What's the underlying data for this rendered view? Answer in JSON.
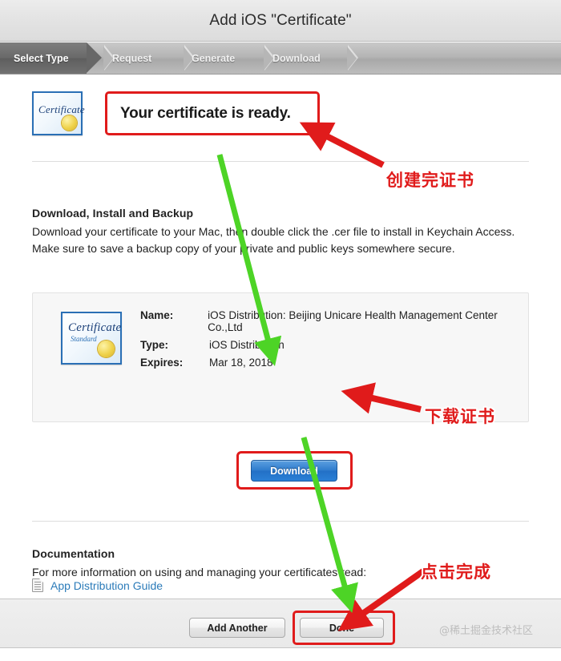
{
  "window": {
    "title": "Add iOS \"Certificate\""
  },
  "steps": [
    {
      "label": "Select Type",
      "state": "active"
    },
    {
      "label": "Request",
      "state": "inactive"
    },
    {
      "label": "Generate",
      "state": "inactive"
    },
    {
      "label": "Download",
      "state": "inactive"
    }
  ],
  "ready": {
    "message": "Your certificate is ready.",
    "icon_word": "Certificate"
  },
  "download_section": {
    "heading": "Download, Install and Backup",
    "body": "Download your certificate to your Mac, then double click the .cer file to install in Keychain Access. Make sure to save a backup copy of your private and public keys somewhere secure."
  },
  "certificate": {
    "icon_word": "Certificate",
    "icon_sub": "Standard",
    "rows": [
      {
        "key": "Name:",
        "value": "iOS Distribution: Beijing Unicare Health Management Center Co.,Ltd"
      },
      {
        "key": "Type:",
        "value": "iOS Distribution"
      },
      {
        "key": "Expires:",
        "value": "Mar 18, 2018"
      }
    ],
    "download_button": "Download"
  },
  "documentation": {
    "heading": "Documentation",
    "body": "For more information on using and managing your certificates read:",
    "link": "App Distribution Guide"
  },
  "footer": {
    "add_another": "Add Another",
    "done": "Done",
    "watermark": "@稀土掘金技术社区"
  },
  "annotations": {
    "created": "创建完证书",
    "download": "下载证书",
    "done": "点击完成",
    "arrow_red_color": "#e01b1b",
    "arrow_green_color": "#4dd426",
    "highlight_color": "#e01b1b"
  }
}
